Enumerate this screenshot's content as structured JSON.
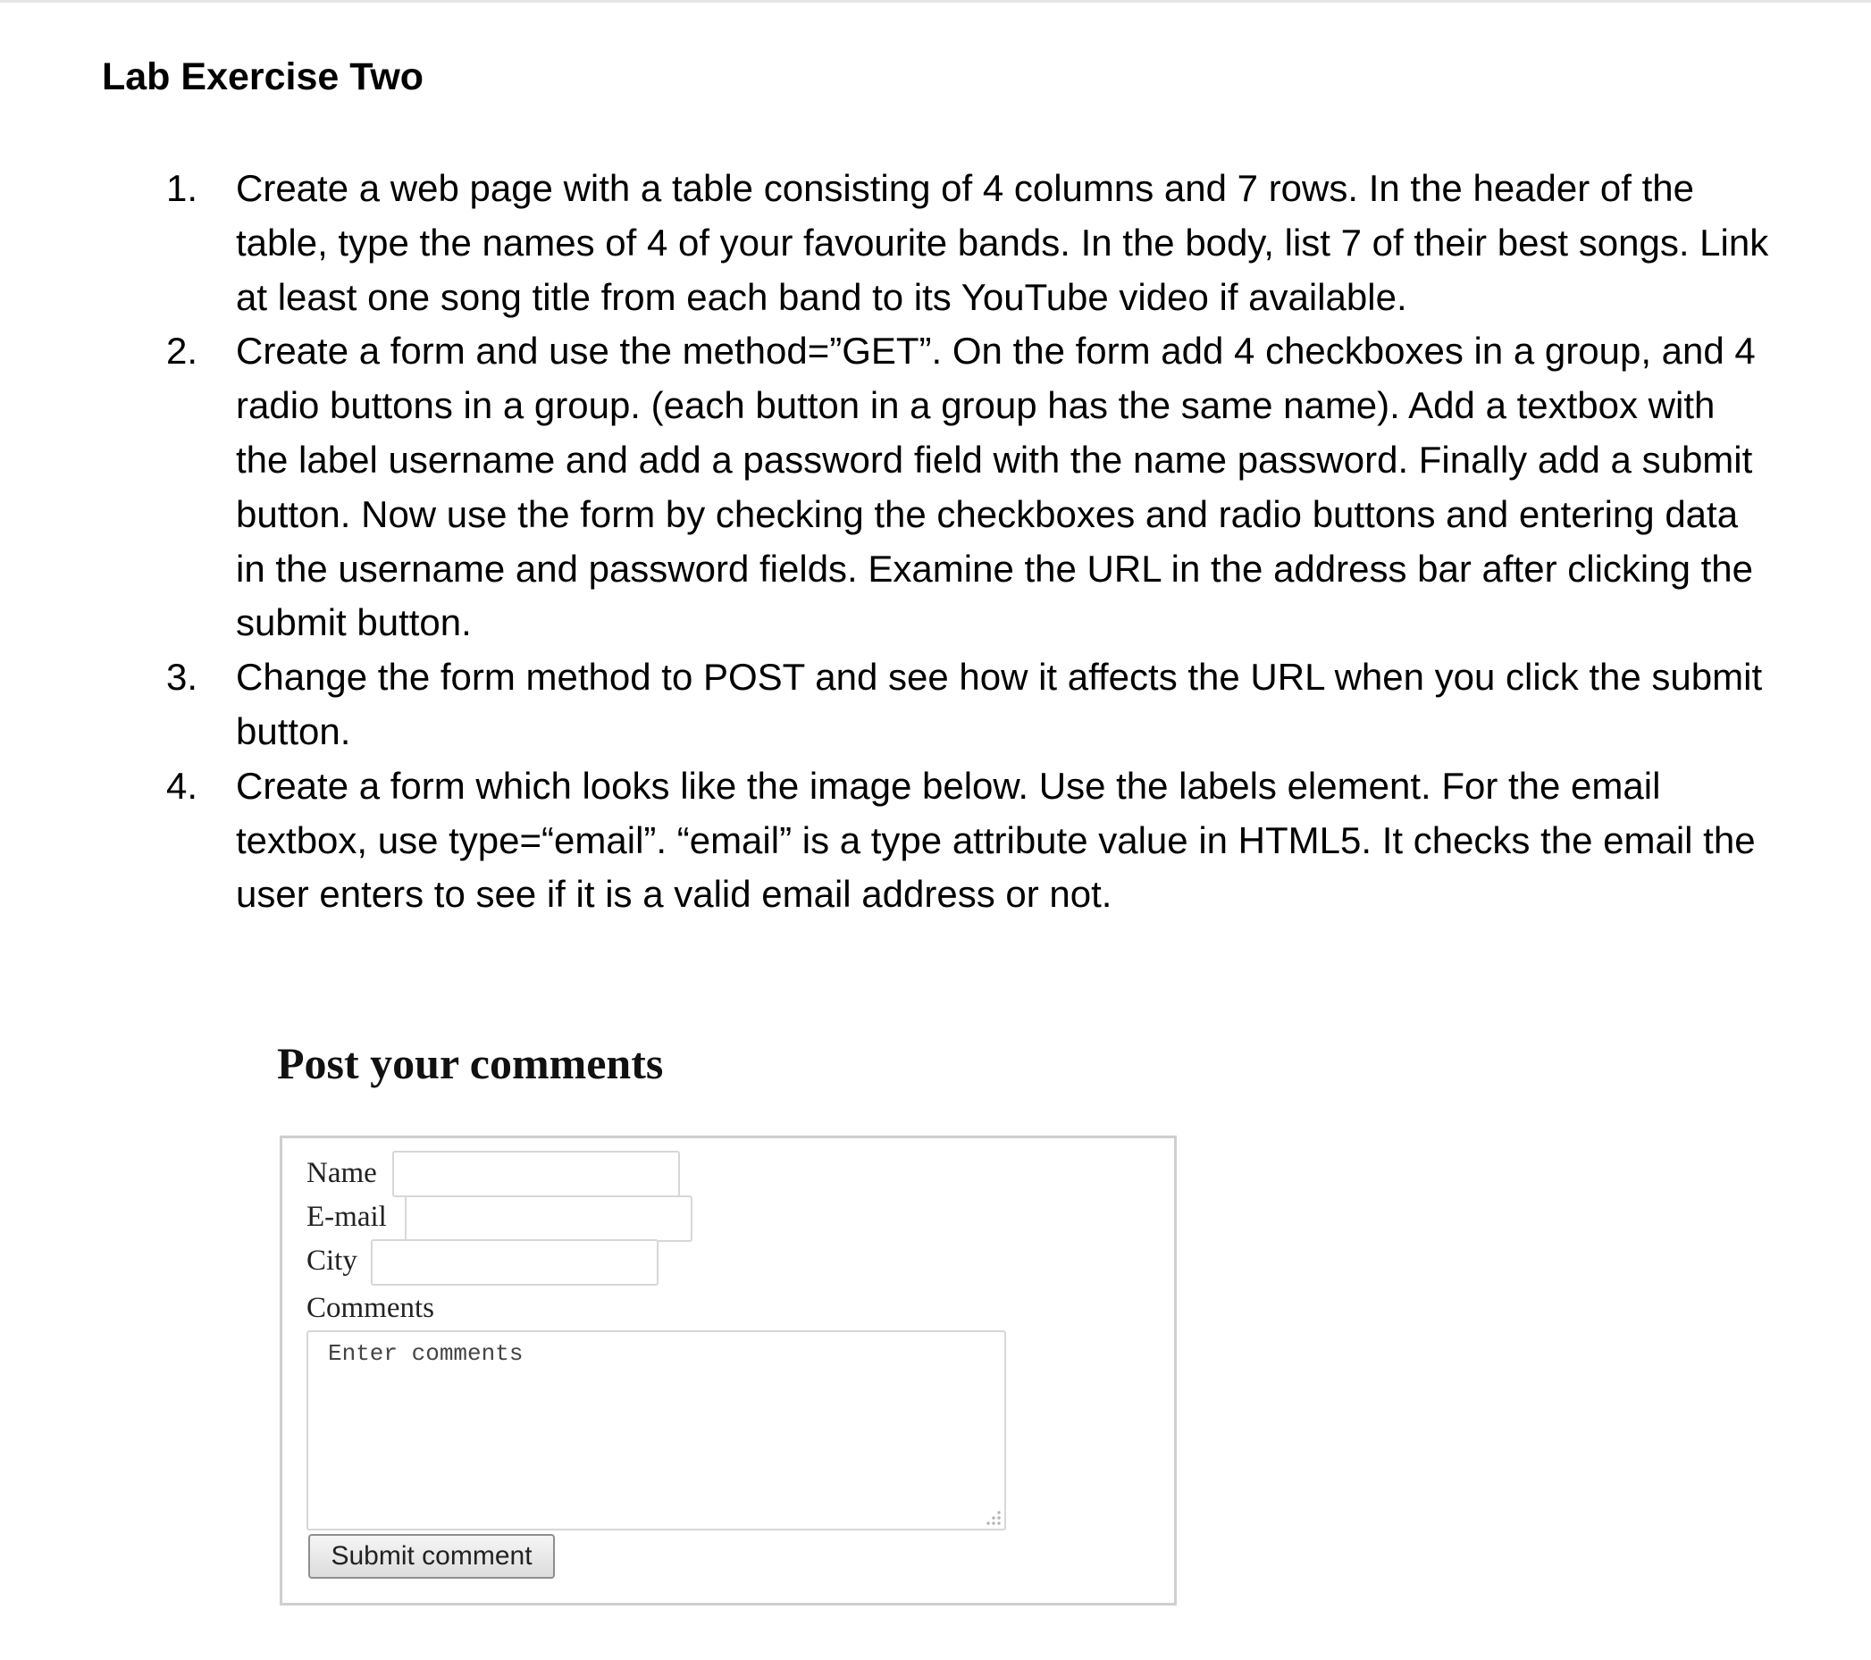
{
  "document": {
    "title": "Lab Exercise Two",
    "items": [
      {
        "number": "1.",
        "text": "Create a web page with a table consisting of 4 columns and 7 rows. In the header of the table, type the names of 4 of your favourite bands. In the body, list 7 of their best songs. Link at least one song title from each band to its YouTube video if available."
      },
      {
        "number": "2.",
        "text": "Create a form and use the method=”GET”. On the form add 4 checkboxes in a group, and 4 radio buttons in a group. (each button in a group has the same name). Add a textbox with the label username and add a password field with the name password. Finally add a submit button. Now use the form by checking the checkboxes and radio buttons and entering data in the username and password fields. Examine the URL in the address bar after clicking the submit button."
      },
      {
        "number": "3.",
        "text": "Change the form method to POST and see how it affects the URL when you click the submit button."
      },
      {
        "number": "4.",
        "text": "Create a form which looks like the image below. Use the labels element. For the email textbox, use type=“email”. “email” is a type attribute value in HTML5. It checks the email the user enters to see if it is a valid email address or not."
      }
    ]
  },
  "mock_form": {
    "heading": "Post your comments",
    "name_label": "Name",
    "email_label": "E-mail",
    "city_label": "City",
    "comments_label": "Comments",
    "comments_text": "Enter comments",
    "submit_label": "Submit comment"
  }
}
